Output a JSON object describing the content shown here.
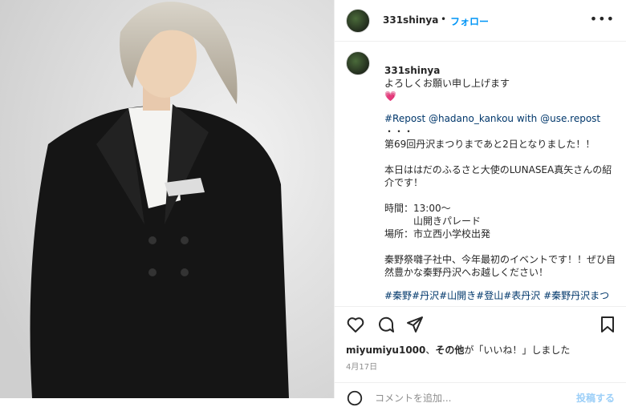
{
  "post": {
    "username": "331shinya",
    "follow_label": "フォロー",
    "more_label": "•••",
    "caption_line": "よろしくお願い申し上げます",
    "heart_emoji": "💗",
    "repost_text": "#Repost @hadano_kankou with @use.repost",
    "caption_body": "・・・\n第69回丹沢まつりまであと2日となりました！！\n\n本日ははだのふるさと大使のLUNASEA真矢さんの紹介です！\n\n時間：13:00～\n　　　山開きパレード\n場所：市立西小学校出発\n\n秦野祭囃子社中、今年最初のイベントです！！ぜひ自然豊かな秦野丹沢へお越しください！",
    "hashtags": "#秦野#丹沢#山開き#登山#表丹沢 #秦野丹沢まつり #unasea #真矢#ママタルト#やぎちゃん#立石純子 #子供大名行列#ボルダリング#クライミン"
  },
  "likes": {
    "user": "miyumiyu1000",
    "others_label": "その他",
    "suffix": "が「いいね！」しました"
  },
  "date": "4月17日",
  "comment": {
    "placeholder": "コメントを追加...",
    "post_label": "投稿する"
  },
  "icons": {
    "like": "heart-icon",
    "comment": "comment-icon",
    "share": "share-icon",
    "save": "bookmark-icon",
    "emoji": "smiley-icon"
  }
}
